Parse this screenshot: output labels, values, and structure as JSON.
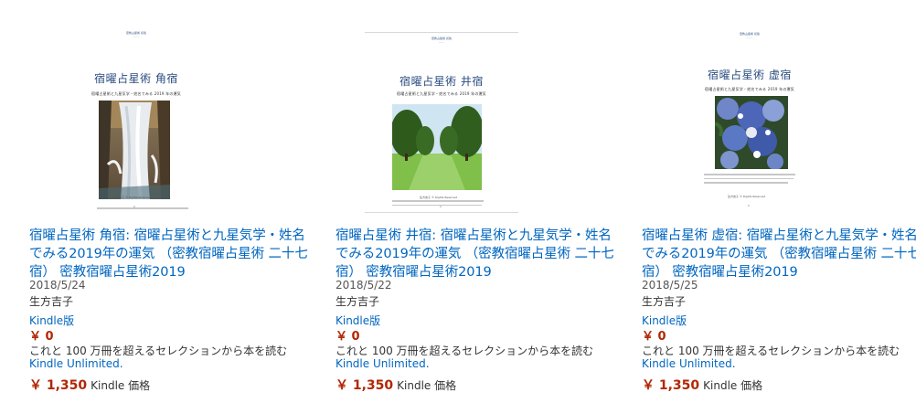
{
  "results": [
    {
      "cover": {
        "header": "密教占星術 初版\n- - -",
        "title": "宿曜占星術 角宿",
        "subtitle": "宿曜占星術と九星気学・姓名でみる 2019 年の運気",
        "author": "生方吉子 © Rights Reserved",
        "page": "1",
        "image": "waterfall"
      },
      "title": "宿曜占星術 角宿: 宿曜占星術と九星気学・姓名でみる2019年の運気 （密教宿曜占星術 二十七宿） 密教宿曜占星術2019",
      "date": "2018/5/24",
      "author": "生方吉子",
      "format": "Kindle版",
      "price": "￥ 0",
      "ku_text": "これと 100 万冊を超えるセレクションから本を読む",
      "ku_link": "Kindle Unlimited.",
      "kindle_price": "￥ 1,350",
      "kindle_price_label": "Kindle 価格"
    },
    {
      "cover": {
        "header": "密教占星術 初版\n- - -",
        "title": "宿曜占星術 井宿",
        "subtitle": "宿曜占星術と九星気学・姓名でみる 2019 年の運気",
        "author": "生方吉子 © Rights Reserved",
        "page": "1",
        "image": "trees"
      },
      "title": "宿曜占星術 井宿: 宿曜占星術と九星気学・姓名でみる2019年の運気 （密教宿曜占星術 二十七宿） 密教宿曜占星術2019",
      "date": "2018/5/22",
      "author": "生方吉子",
      "format": "Kindle版",
      "price": "￥ 0",
      "ku_text": "これと 100 万冊を超えるセレクションから本を読む",
      "ku_link": "Kindle Unlimited.",
      "kindle_price": "￥ 1,350",
      "kindle_price_label": "Kindle 価格"
    },
    {
      "cover": {
        "header": "密教占星術 初版\n- - -",
        "title": "宿曜占星術 虚宿",
        "subtitle": "宿曜占星術と九星気学・姓名でみる 2019 年の運気",
        "author": "生方吉子 © Rights Reserved",
        "page": "1",
        "image": "hydrangea"
      },
      "title": "宿曜占星術 虚宿: 宿曜占星術と九星気学・姓名でみる2019年の運気 （密教宿曜占星術 二十七宿） 密教宿曜占星術2019",
      "date": "2018/5/25",
      "author": "生方吉子",
      "format": "Kindle版",
      "price": "￥ 0",
      "ku_text": "これと 100 万冊を超えるセレクションから本を読む",
      "ku_link": "Kindle Unlimited.",
      "kindle_price": "￥ 1,350",
      "kindle_price_label": "Kindle 価格"
    }
  ],
  "colors": {
    "link": "#0066c0",
    "price": "#b12704",
    "text": "#333333"
  }
}
